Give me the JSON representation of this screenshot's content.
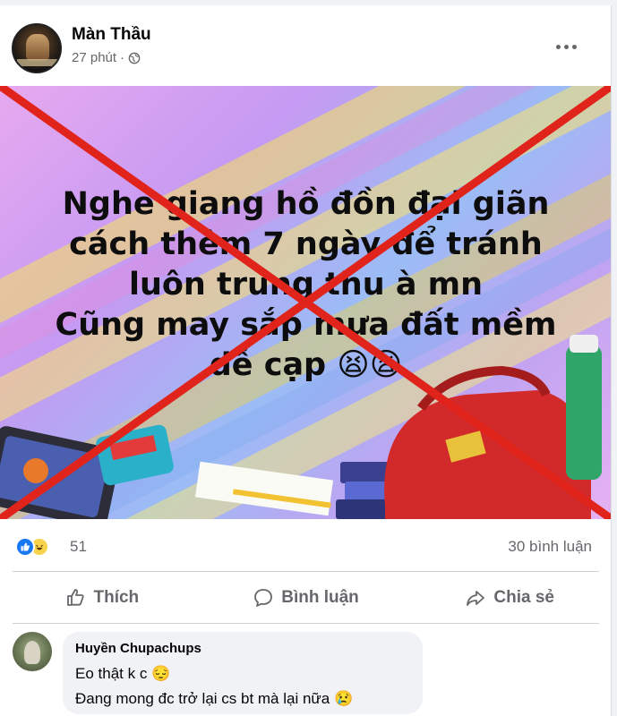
{
  "post": {
    "author": "Màn Thầu",
    "time": "27 phút",
    "separator": "·",
    "image_text": [
      "Nghe giang hồ đồn đại giãn",
      "cách thêm 7 ngày để tránh",
      "luôn trung thu à mn",
      "Cũng may sắp mưa đất mềm",
      "dễ cạp 😫😫"
    ]
  },
  "stats": {
    "reaction_count": "51",
    "comment_count": "30 bình luận"
  },
  "actions": {
    "like": "Thích",
    "comment": "Bình luận",
    "share": "Chia sẻ"
  },
  "comment": {
    "name": "Huyền Chupachups",
    "line1": "Eo thật k c 😔",
    "line2": "Đang mong đc trở lại cs bt mà lại nữa 😢"
  },
  "colors": {
    "cross": "#e0241b",
    "like_blue": "#1877f2",
    "secondary_text": "#65676b"
  },
  "icons": [
    "globe-icon",
    "more-options-icon",
    "like-reaction-icon",
    "haha-reaction-icon",
    "like-icon",
    "comment-icon",
    "share-icon"
  ]
}
